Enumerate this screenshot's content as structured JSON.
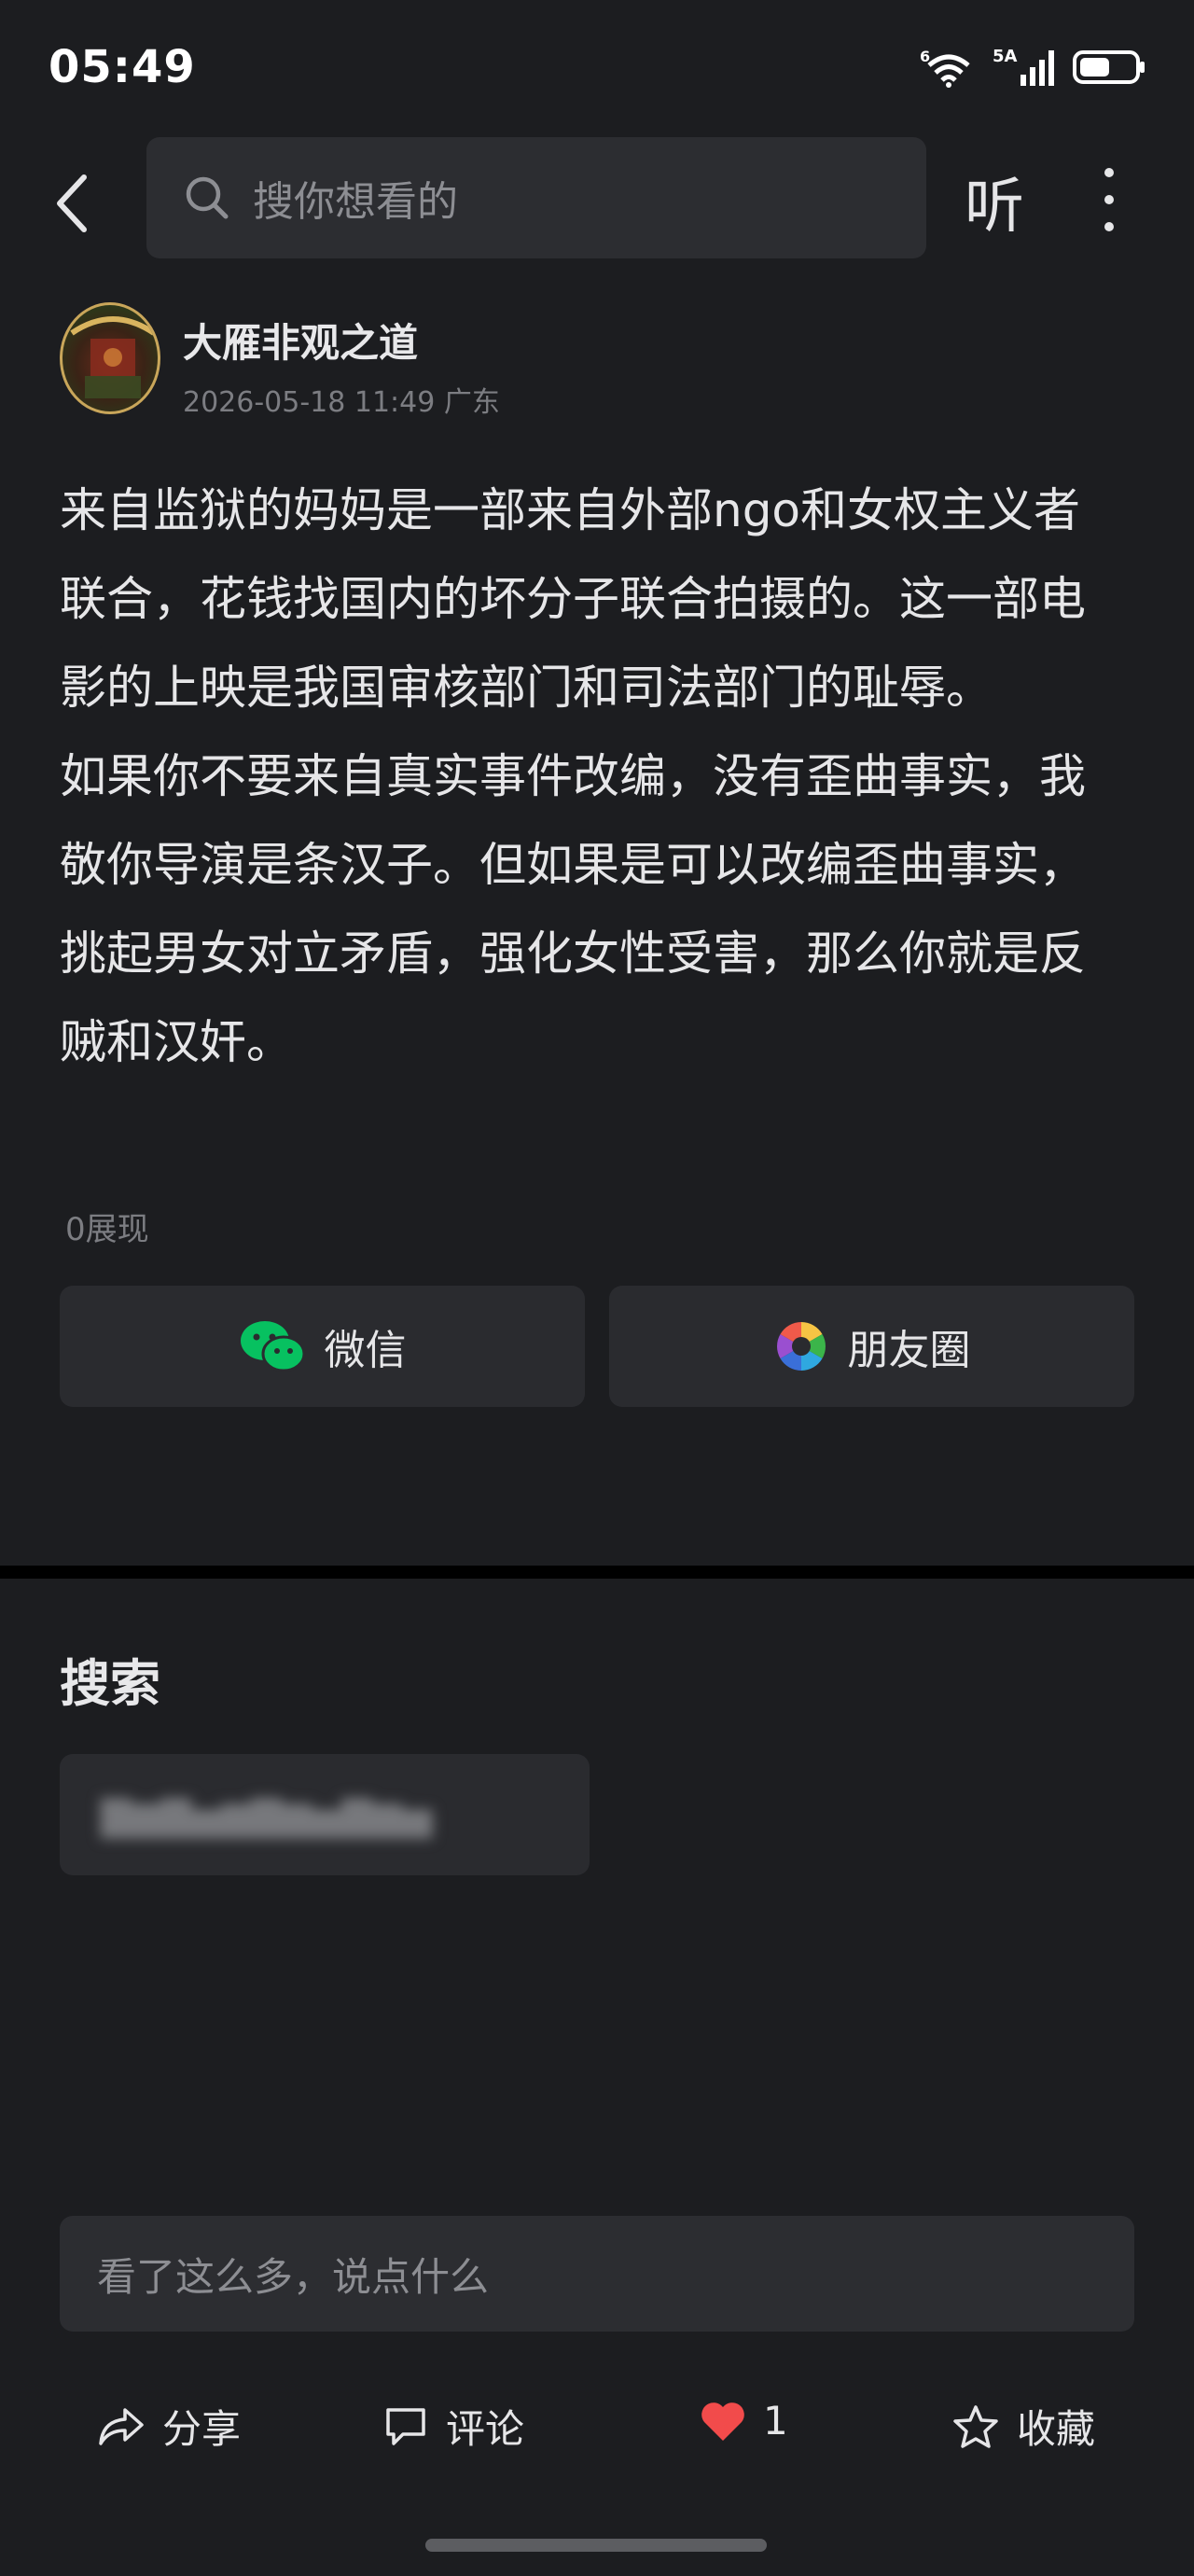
{
  "status_bar": {
    "time": "05:49",
    "network_label": "5A",
    "wifi_label": "6",
    "battery_level": 0.55
  },
  "nav": {
    "search_placeholder": "搜你想看的",
    "listen_label": "听"
  },
  "author": {
    "name": "大雁非观之道",
    "meta": "2026-05-18 11:49 广东"
  },
  "post": {
    "paragraphs": [
      "来自监狱的妈妈是一部来自外部ngo和女权主义者联合，花钱找国内的坏分子联合拍摄的。这一部电影的上映是我国审核部门和司法部门的耻辱。",
      "如果你不要来自真实事件改编，没有歪曲事实，我敬你导演是条汉子。但如果是可以改编歪曲事实，挑起男女对立矛盾，强化女性受害，那么你就是反贼和汉奸。"
    ],
    "views": "0展现"
  },
  "share": {
    "wechat_label": "微信",
    "moments_label": "朋友圈"
  },
  "search_section": {
    "title": "搜索",
    "chip_text": "▇▆▇▅▆▇▆▅▇▆▅"
  },
  "comment": {
    "placeholder": "看了这么多，说点什么"
  },
  "actions": {
    "share_label": "分享",
    "comment_label": "评论",
    "like_count": "1",
    "favorite_label": "收藏"
  },
  "colors": {
    "background": "#1c1d20",
    "surface": "#2a2b2f",
    "like_red": "#f24b4b",
    "wechat_green": "#07c160"
  }
}
